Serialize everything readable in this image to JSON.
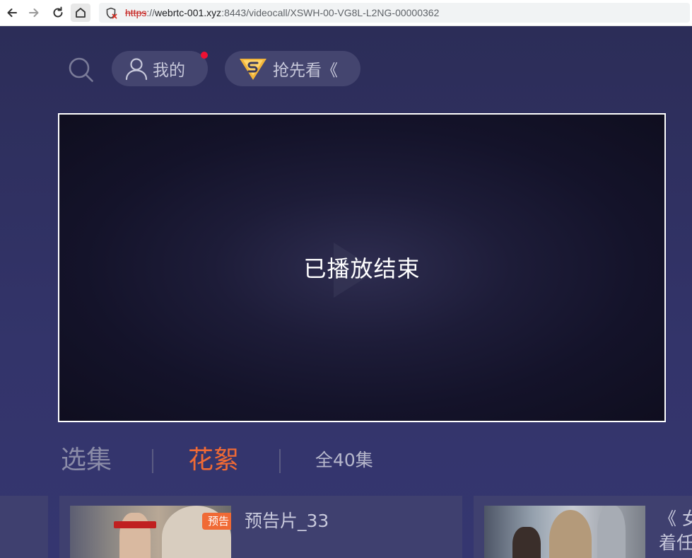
{
  "browser": {
    "url_scheme": "https",
    "url_sep": "://",
    "url_host": "webrtc-001.xyz",
    "url_rest": ":8443/videocall/XSWH-00-VG8L-L2NG-00000362",
    "icons": [
      "back-icon",
      "forward-icon",
      "reload-icon",
      "home-icon",
      "insecure-shield-icon"
    ]
  },
  "header": {
    "search_icon": "search-icon",
    "mine_label": "我的",
    "mine_has_notification": true,
    "first_look_label": "抢先看《",
    "colors": {
      "notification_dot": "#ee1133",
      "pill_bg": "#44456f"
    }
  },
  "player": {
    "status_text": "已播放结束"
  },
  "tabs": {
    "episodes": "选集",
    "extras": "花絮",
    "count": "全40集",
    "active": "extras",
    "colors": {
      "active": "#f06a35"
    }
  },
  "cards": [
    {
      "badge": "预告",
      "title": "预告片_33"
    },
    {
      "title": "《 女",
      "title_line2": "着任"
    }
  ]
}
